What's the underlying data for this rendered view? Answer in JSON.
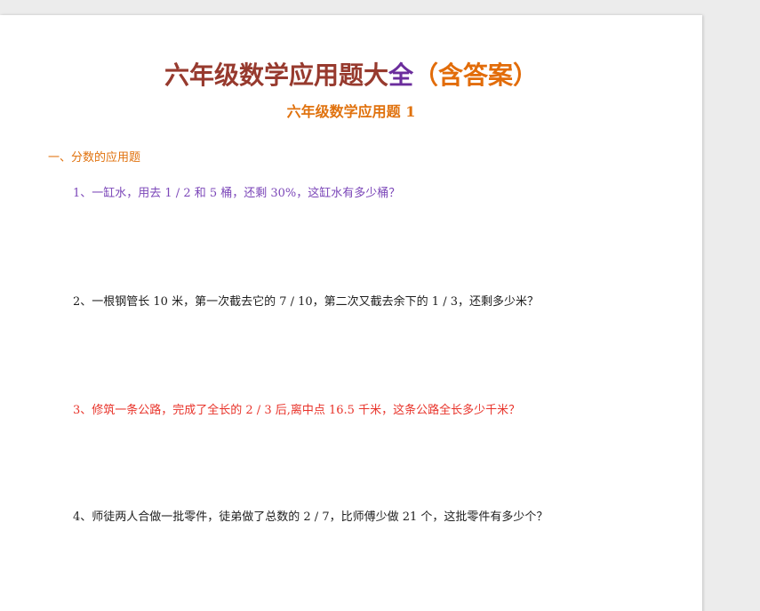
{
  "document": {
    "title": {
      "part1": "六年级数学应用题大",
      "part2": "全",
      "part3": "（含答案）"
    },
    "subtitle": "六年级数学应用题 1",
    "section_heading": "一、分数的应用题",
    "questions": [
      "1、一缸水，用去 1 / 2 和 5 桶，还剩 30%，这缸水有多少桶？",
      "2、一根钢管长 10 米，第一次截去它的 7 / 10，第二次又截去余下的 1 / 3，还剩多少米？",
      "3、修筑一条公路，完成了全长的 2 / 3 后,离中点 16.5 千米，这条公路全长多少千米？",
      "4、师徒两人合做一批零件，徒弟做了总数的 2 / 7，比师傅少做 21 个，这批零件有多少个？"
    ]
  },
  "colors": {
    "title_part1": "#973a2e",
    "title_part2": "#6b2d9c",
    "title_part3": "#e26c09",
    "subtitle": "#e0720e",
    "section_heading": "#e0720e",
    "question_1": "#7b46b8",
    "question_2": "#1e1e1e",
    "question_3": "#e8332a",
    "question_4": "#1e1e1e"
  }
}
